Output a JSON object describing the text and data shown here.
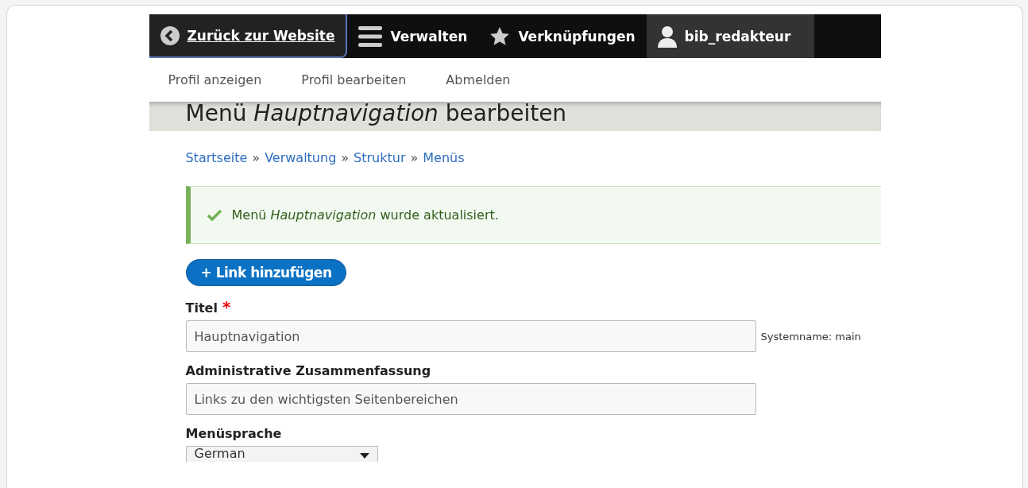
{
  "toolbar": {
    "items": [
      {
        "kind": "back",
        "label": "Zurück zur Website",
        "selected": false
      },
      {
        "kind": "menu",
        "label": "Verwalten",
        "selected": false
      },
      {
        "kind": "star",
        "label": "Verknüpfungen",
        "selected": false
      },
      {
        "kind": "user",
        "label": "bib_redakteur",
        "selected": true
      }
    ]
  },
  "tray": {
    "items": [
      "Profil anzeigen",
      "Profil bearbeiten",
      "Abmelden"
    ]
  },
  "page_title": "Menü *Hauptnavigation* bearbeiten",
  "breadcrumb": [
    "Startseite",
    "Verwaltung",
    "Struktur",
    "Menüs"
  ],
  "breadcrumb_separator": "»",
  "message": {
    "kind": "status",
    "text": "Menü *Hauptnavigation* wurde aktualisiert."
  },
  "action_button": "+ Link hinzufügen",
  "form": {
    "fields": [
      {
        "kind": "text",
        "label": "Titel",
        "required": true,
        "value": "Hauptnavigation",
        "suffix": "Systemname: main"
      },
      {
        "kind": "text",
        "label": "Administrative Zusammenfassung",
        "required": false,
        "value": "Links zu den wichtigsten Seitenbereichen"
      },
      {
        "kind": "select",
        "label": "Menüsprache",
        "required": false,
        "value": "German"
      }
    ]
  },
  "required_mark": "*"
}
